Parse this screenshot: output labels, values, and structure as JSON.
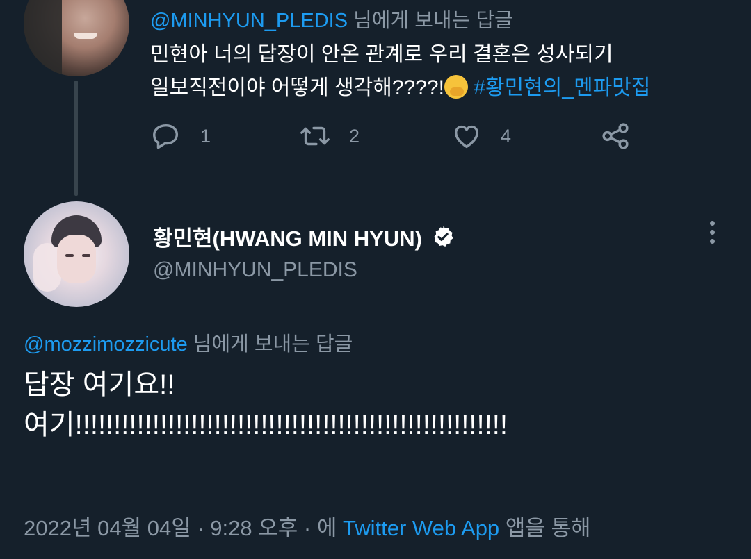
{
  "parent_tweet": {
    "reply_handle": "@MINHYUN_PLEDIS",
    "reply_suffix": "님에게 보내는 답글",
    "text_line1": "민현아 너의 답장이 안온 관계로 우리 결혼은 성사되기",
    "text_line2_pre": "일보직전이야 어떻게 생각해????!",
    "emoji": "face-with-hand-over-mouth",
    "hashtag": "#황민현의_멘파맛집",
    "actions": {
      "reply_count": "1",
      "retweet_count": "2",
      "like_count": "4"
    }
  },
  "main_tweet": {
    "display_name": "황민현(HWANG MIN HYUN)",
    "handle": "@MINHYUN_PLEDIS",
    "reply_handle": "@mozzimozzicute",
    "reply_suffix": "님에게 보내는 답글",
    "text_line1": "답장 여기요!!",
    "text_line2": "여기!!!!!!!!!!!!!!!!!!!!!!!!!!!!!!!!!!!!!!!!!!!!!!!!!!!!!!!!",
    "date": "2022년 04월 04일",
    "sep1": "·",
    "time": "9:28 오후",
    "sep2": "·",
    "via_prefix": "에",
    "client": "Twitter Web App",
    "via_suffix": "앱을 통해"
  },
  "colors": {
    "background": "#15202b",
    "link": "#1d9bf0",
    "muted": "#8b98a5"
  }
}
